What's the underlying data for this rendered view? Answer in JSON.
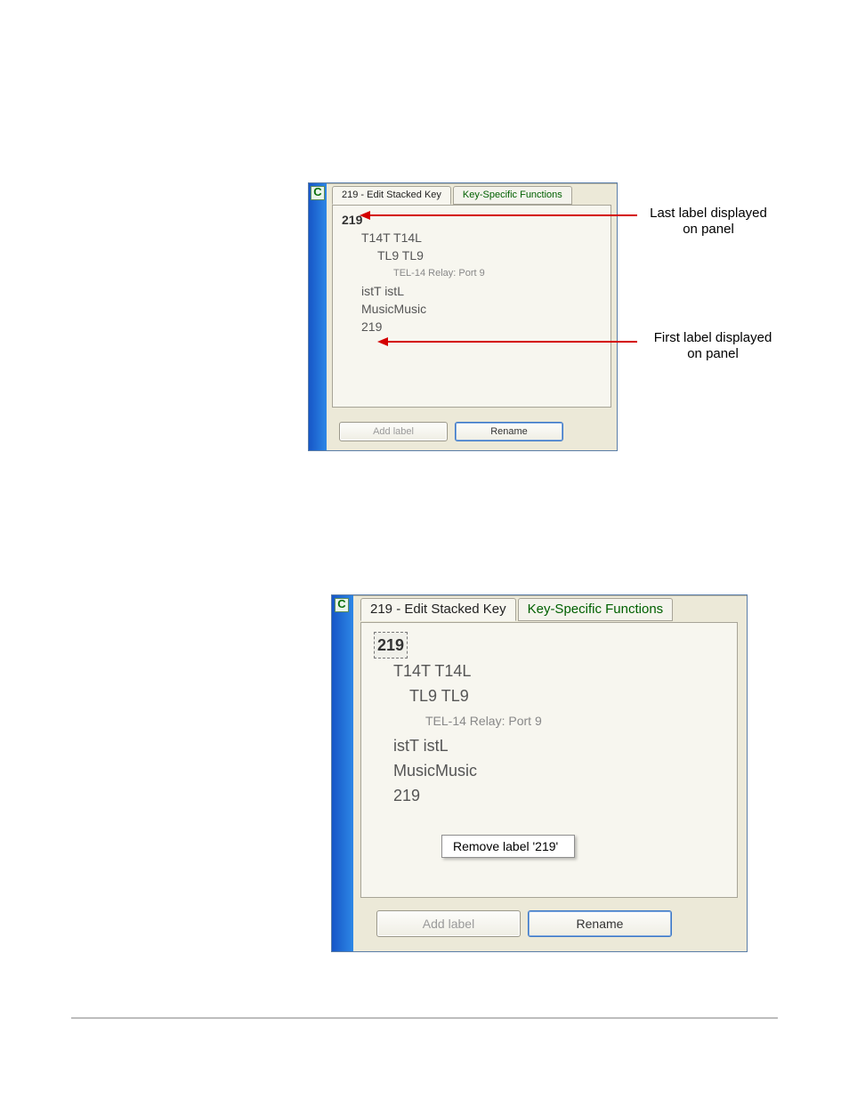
{
  "figure1": {
    "tab_active": "219 -  Edit Stacked Key",
    "tab_inactive": "Key-Specific Functions",
    "tree": {
      "l0_top": "219",
      "l1_a": "T14T T14L",
      "l2_a": "TL9  TL9",
      "l3_a": "TEL-14 Relay: Port 9",
      "l1_b": "istT istL",
      "l1_c": "MusicMusic",
      "l1_d": "219"
    },
    "btn_add": "Add label",
    "btn_rename": "Rename"
  },
  "callouts": {
    "last": "Last label displayed\non panel",
    "first": "First label displayed\non panel"
  },
  "figure2": {
    "tab_active": "219 -  Edit Stacked Key",
    "tab_inactive": "Key-Specific Functions",
    "tree": {
      "l0_top": "219",
      "l1_a": "T14T T14L",
      "l2_a": "TL9  TL9",
      "l3_a": "TEL-14 Relay: Port 9",
      "l1_b": "istT istL",
      "l1_c": "MusicMusic",
      "l1_d": "219"
    },
    "context_menu": "Remove label '219'",
    "btn_add": "Add label",
    "btn_rename": "Rename"
  }
}
